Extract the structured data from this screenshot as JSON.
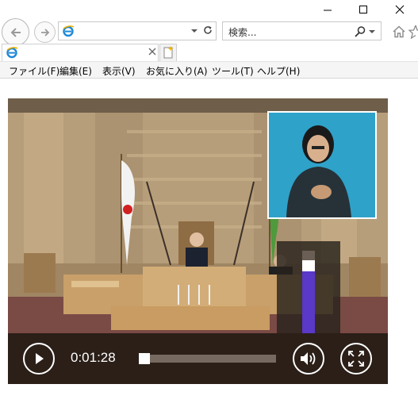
{
  "window": {
    "controls": [
      "minimize",
      "maximize",
      "close"
    ]
  },
  "address_bar": {
    "value": "",
    "icon": "ie-logo-icon"
  },
  "search": {
    "placeholder": "検索..."
  },
  "tab": {
    "title": "",
    "icon": "ie-logo-icon"
  },
  "menu": {
    "items": [
      {
        "label": "ファイル(F)"
      },
      {
        "label": "編集(E)"
      },
      {
        "label": "表示(V)"
      },
      {
        "label": "お気に入り(A)"
      },
      {
        "label": "ツール(T)"
      },
      {
        "label": "ヘルプ(H)"
      }
    ]
  },
  "player": {
    "time": "0:01:28",
    "seek_progress": 0.0,
    "volume_level": 0.88,
    "colors": {
      "volume_fill": "#5a38c8",
      "control_bar": "#1e1812"
    }
  }
}
